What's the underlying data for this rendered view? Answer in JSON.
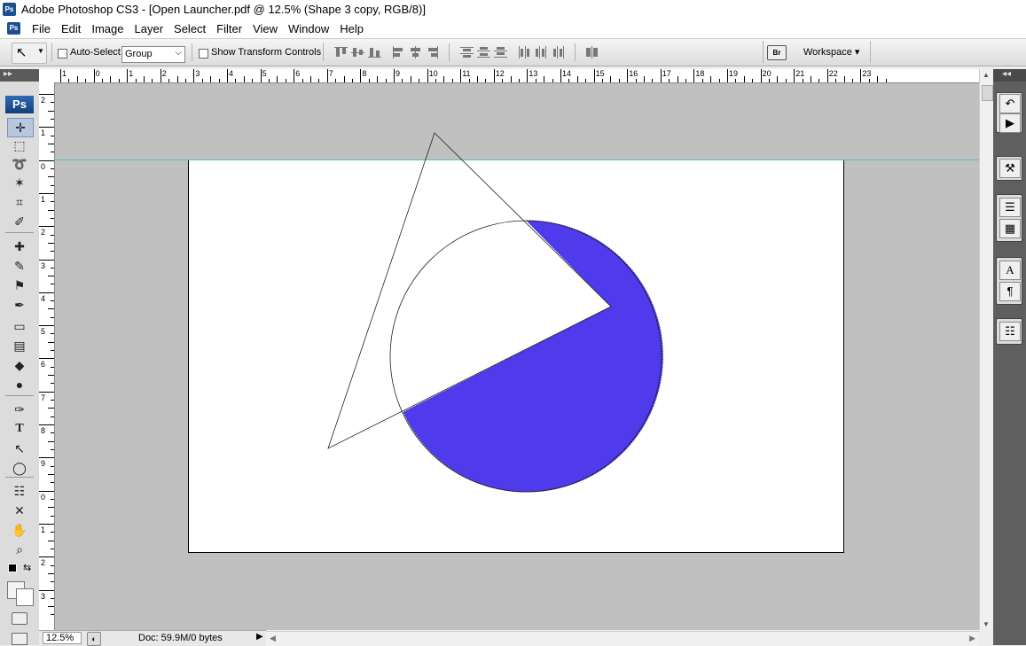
{
  "window": {
    "title": "Adobe Photoshop CS3 - [Open Launcher.pdf @ 12.5% (Shape 3 copy, RGB/8)]",
    "app_badge": "Ps"
  },
  "menubar": {
    "items": [
      "File",
      "Edit",
      "Image",
      "Layer",
      "Select",
      "Filter",
      "View",
      "Window",
      "Help"
    ]
  },
  "options": {
    "auto_select_label": "Auto-Select:",
    "auto_select_checked": false,
    "auto_select_value": "Group",
    "show_transform_label": "Show Transform Controls",
    "show_transform_checked": false,
    "workspace_label": "Workspace ▾",
    "bridge_badge": "Br"
  },
  "toolbox": {
    "ps_logo": "Ps",
    "collapse_glyph": "▸▸",
    "tools": [
      {
        "name": "move-tool-icon",
        "glyph": "✛",
        "active": true
      },
      {
        "name": "marquee-tool-icon",
        "glyph": "⬚"
      },
      {
        "name": "lasso-tool-icon",
        "glyph": "➰"
      },
      {
        "name": "magic-wand-tool-icon",
        "glyph": "✶"
      },
      {
        "name": "crop-tool-icon",
        "glyph": "⌗"
      },
      {
        "name": "slice-tool-icon",
        "glyph": "✐"
      },
      {
        "name": "healing-brush-tool-icon",
        "glyph": "✚"
      },
      {
        "name": "brush-tool-icon",
        "glyph": "✎"
      },
      {
        "name": "clone-stamp-tool-icon",
        "glyph": "⚑"
      },
      {
        "name": "history-brush-tool-icon",
        "glyph": "✒"
      },
      {
        "name": "eraser-tool-icon",
        "glyph": "▭"
      },
      {
        "name": "gradient-tool-icon",
        "glyph": "▤"
      },
      {
        "name": "blur-tool-icon",
        "glyph": "◆"
      },
      {
        "name": "dodge-tool-icon",
        "glyph": "●"
      },
      {
        "name": "pen-tool-icon",
        "glyph": "✑"
      },
      {
        "name": "type-tool-icon",
        "glyph": "T"
      },
      {
        "name": "path-selection-tool-icon",
        "glyph": "↖"
      },
      {
        "name": "ellipse-tool-icon",
        "glyph": "◯"
      },
      {
        "name": "notes-tool-icon",
        "glyph": "☷"
      },
      {
        "name": "eyedropper-tool-icon",
        "glyph": "✕"
      },
      {
        "name": "hand-tool-icon",
        "glyph": "✋"
      },
      {
        "name": "zoom-tool-icon",
        "glyph": "⌕"
      }
    ]
  },
  "rulers": {
    "h_labels": [
      "1",
      "0",
      "1",
      "2",
      "3",
      "4",
      "5",
      "6",
      "7",
      "8",
      "9",
      "10",
      "11",
      "12",
      "13",
      "14",
      "15",
      "16",
      "17",
      "18",
      "19",
      "20",
      "21",
      "22",
      "23"
    ],
    "v_labels": [
      "2",
      "1",
      "0",
      "1",
      "2",
      "3",
      "4",
      "5",
      "6",
      "7",
      "8",
      "9",
      "0",
      "1",
      "2",
      "3"
    ]
  },
  "canvas": {
    "shape_fill_color": "#4f3aec",
    "guide_color": "#49c8c8",
    "canvas_bg": "#c0c0c0"
  },
  "status": {
    "zoom": "12.5%",
    "doc_info": "Doc: 59.9M/0 bytes"
  },
  "right_dock": {
    "collapse_glyph": "◂◂",
    "groups": [
      [
        "history-panel-icon",
        "actions-panel-icon"
      ],
      [
        "tools-panel-icon"
      ],
      [
        "layers-panel-icon",
        "channels-panel-icon"
      ],
      [
        "character-panel-icon",
        "paragraph-panel-icon"
      ],
      [
        "info-panel-icon"
      ]
    ]
  }
}
